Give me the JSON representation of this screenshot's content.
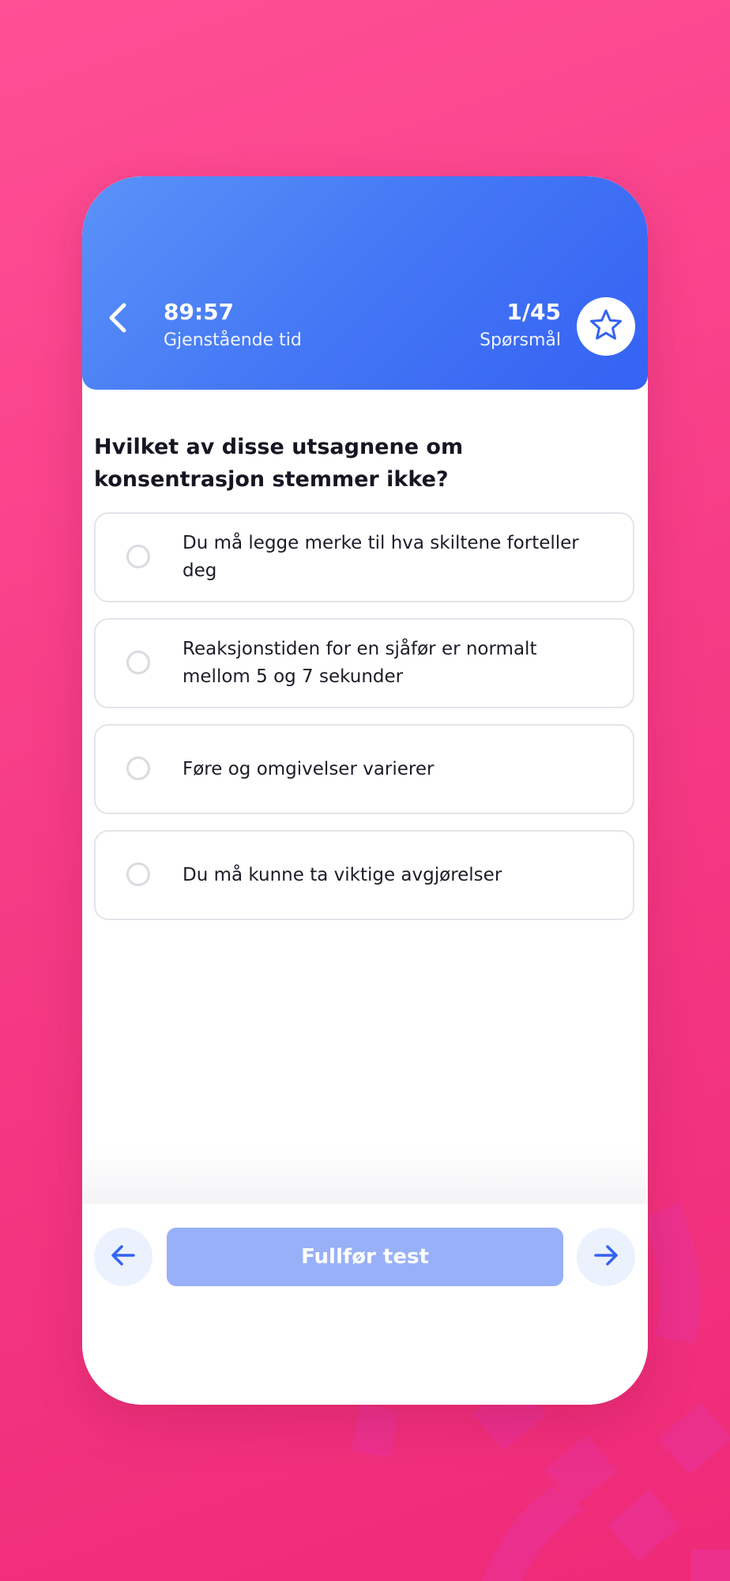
{
  "colors": {
    "background": "#f63c86",
    "header_gradient_start": "#5a92f8",
    "header_gradient_end": "#3462f3",
    "accent_blue": "#3462f3",
    "finish_button": "#98b0f7",
    "nav_button": "#ecf1fe"
  },
  "header": {
    "back_icon": "chevron-left-icon",
    "timer_value": "89:57",
    "timer_label": "Gjenstående tid",
    "progress_value": "1/45",
    "progress_label": "Spørsmål",
    "bookmark_icon": "star-outline-icon"
  },
  "question": {
    "text": "Hvilket av disse utsagnene om konsentrasjon stemmer ikke?",
    "options": [
      {
        "label": "Du må legge merke til hva skiltene forteller deg",
        "selected": false
      },
      {
        "label": "Reaksjonstiden for en sjåfør er normalt mellom 5 og 7 sekunder",
        "selected": false
      },
      {
        "label": "Føre og omgivelser varierer",
        "selected": false
      },
      {
        "label": "Du må kunne ta viktige avgjørelser",
        "selected": false
      }
    ]
  },
  "footer": {
    "prev_icon": "arrow-left-icon",
    "finish_label": "Fullfør test",
    "next_icon": "arrow-right-icon"
  }
}
